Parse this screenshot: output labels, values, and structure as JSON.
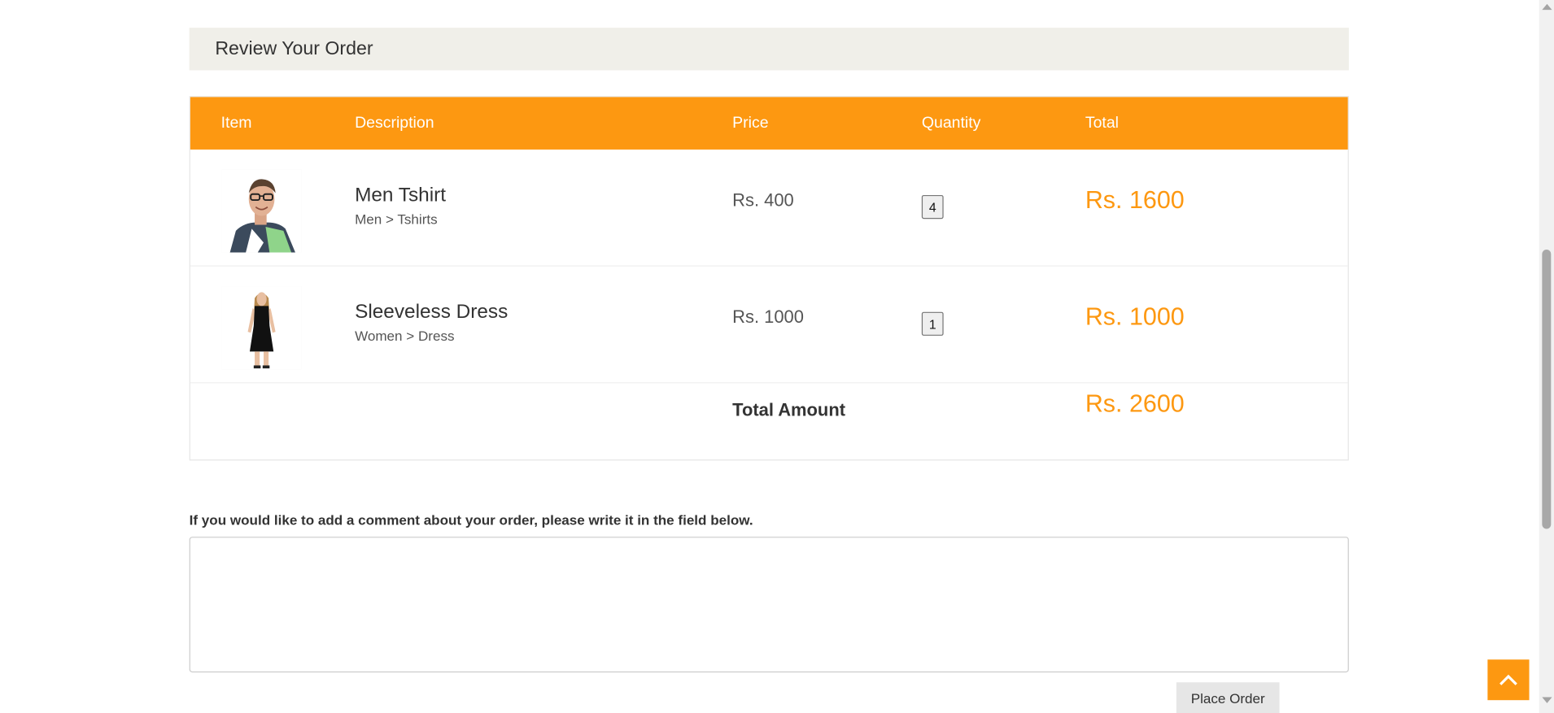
{
  "review": {
    "heading": "Review Your Order"
  },
  "table": {
    "headers": {
      "item": "Item",
      "description": "Description",
      "price": "Price",
      "quantity": "Quantity",
      "total": "Total"
    },
    "rows": [
      {
        "name": "Men Tshirt",
        "category": "Men > Tshirts",
        "price": "Rs. 400",
        "quantity": "4",
        "total": "Rs. 1600"
      },
      {
        "name": "Sleeveless Dress",
        "category": "Women > Dress",
        "price": "Rs. 1000",
        "quantity": "1",
        "total": "Rs. 1000"
      }
    ],
    "total_label": "Total Amount",
    "total_value": "Rs. 2600"
  },
  "comment": {
    "label": "If you would like to add a comment about your order, please write it in the field below.",
    "value": ""
  },
  "actions": {
    "place_order": "Place Order"
  },
  "icons": {
    "back_to_top": "chevron-up-icon"
  },
  "colors": {
    "accent": "#fd9811",
    "heading_bg": "#f0efe9"
  }
}
